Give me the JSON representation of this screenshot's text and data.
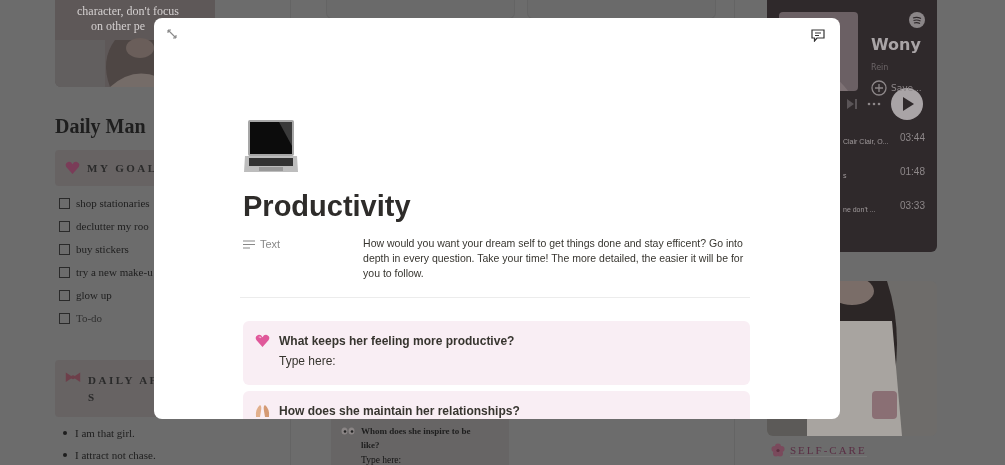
{
  "background": {
    "left": {
      "photo_caption": [
        "character, don't focus",
        "on other pe"
      ],
      "heading": "Daily Man",
      "goals": {
        "title": "MY GOAL",
        "items": [
          {
            "label": "shop stationaries",
            "checked": false
          },
          {
            "label": "declutter my roo",
            "checked": false
          },
          {
            "label": "buy stickers",
            "checked": false
          },
          {
            "label": "try a new make-u",
            "checked": false
          },
          {
            "label": "glow up",
            "checked": false
          }
        ],
        "new_item": {
          "placeholder": "To-do",
          "checked": false
        }
      },
      "affirmations": {
        "title": [
          "DAILY AF",
          "S"
        ],
        "items": [
          "I am that girl.",
          "I attract not chase."
        ]
      }
    },
    "middle_card": {
      "question": "Whom does she inspire to be like?",
      "answer": "Type here:"
    },
    "player": {
      "title": "Wony",
      "artist": "Rein",
      "save": "Save...",
      "tracks": [
        {
          "subtitle": "Clair Clair, O...",
          "duration": "03:44"
        },
        {
          "subtitle": "s",
          "duration": "01:48"
        },
        {
          "subtitle": "ne don't ...",
          "duration": "03:33"
        }
      ]
    },
    "self_care": "SELF-CARE"
  },
  "modal": {
    "title": "Productivity",
    "property": {
      "label": "Text",
      "value": "How would you want your dream self to get things done and stay efficent? Go into depth in every question. Take your time! The more detailed, the easier it will be for you to follow."
    },
    "callouts": [
      {
        "kind": "heart",
        "question": "What keeps her feeling more productive?",
        "answer": "Type here:"
      },
      {
        "kind": "hands",
        "question": "How does she maintain her relationships?"
      }
    ]
  }
}
